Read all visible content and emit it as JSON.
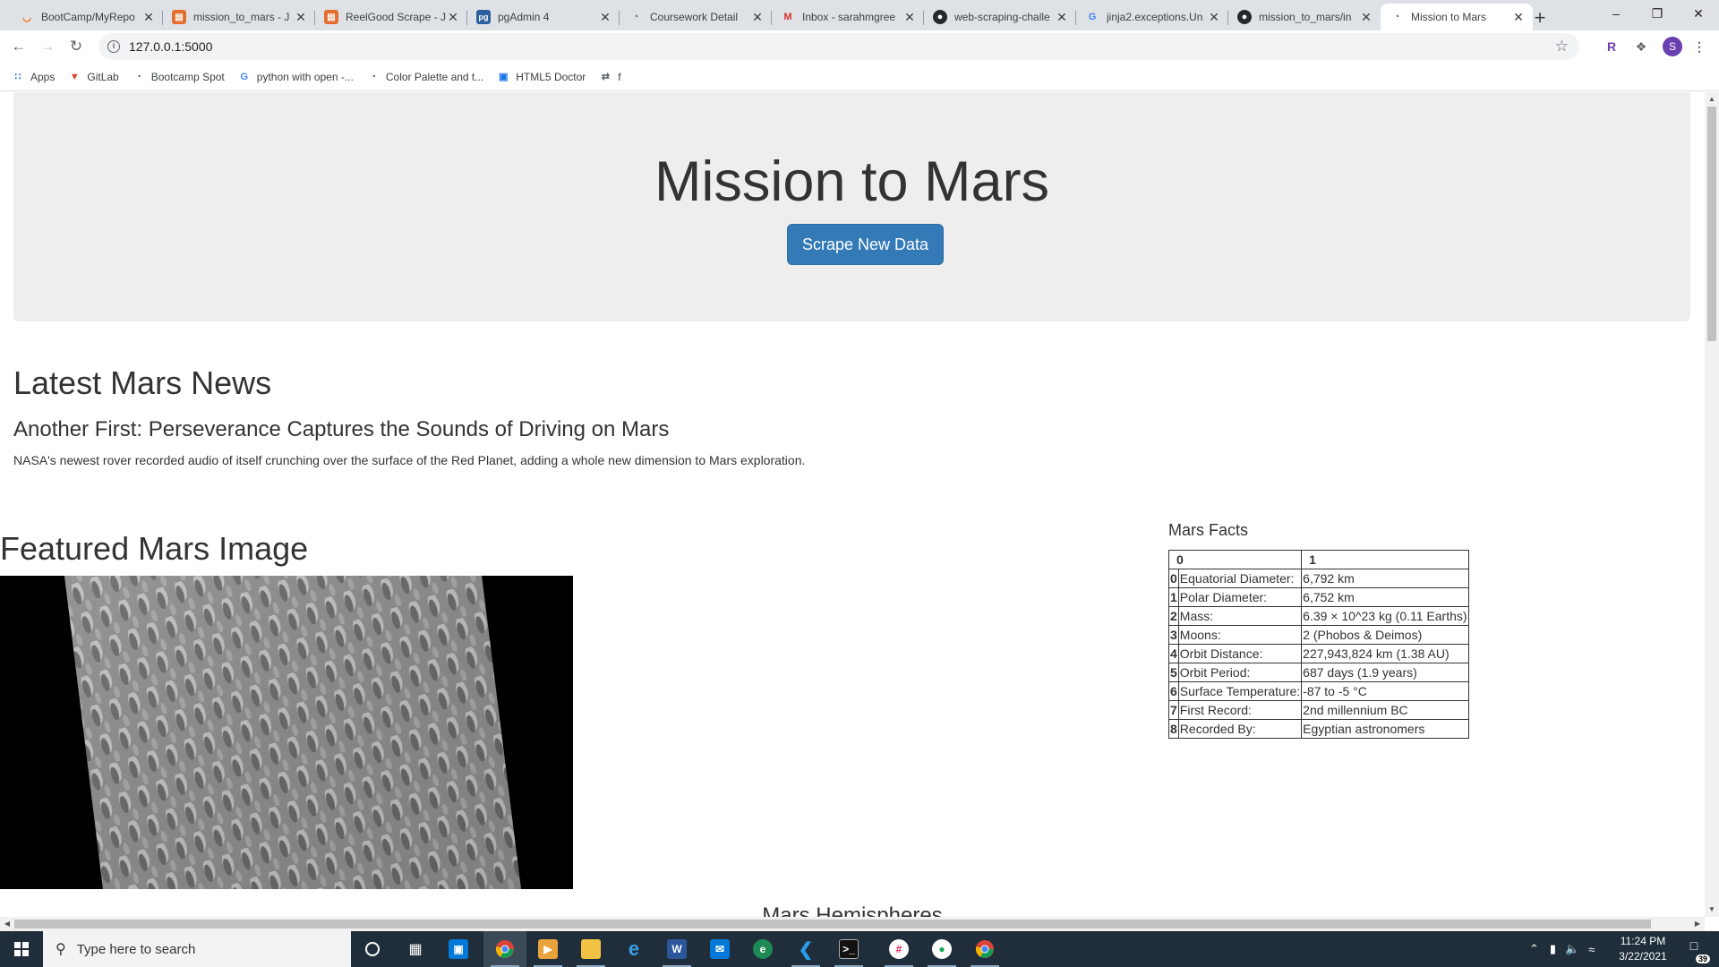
{
  "browser": {
    "tabs": [
      {
        "title": "BootCamp/MyRepo",
        "icon": "bootcamp-icon",
        "color": "#ff6600"
      },
      {
        "title": "mission_to_mars - J",
        "icon": "jupyter-icon",
        "color": "#e46e2e"
      },
      {
        "title": "ReelGood Scrape - J",
        "icon": "jupyter-icon",
        "color": "#e46e2e"
      },
      {
        "title": "pgAdmin 4",
        "icon": "pgadmin-icon",
        "color": "#2c5f9e"
      },
      {
        "title": "Coursework Detail",
        "icon": "globe-icon",
        "color": "#5f6368"
      },
      {
        "title": "Inbox - sarahmgree",
        "icon": "gmail-icon",
        "color": "#d93025"
      },
      {
        "title": "web-scraping-challe",
        "icon": "github-icon",
        "color": "#24292e"
      },
      {
        "title": "jinja2.exceptions.Un",
        "icon": "google-icon",
        "color": "#4285f4"
      },
      {
        "title": "mission_to_mars/in",
        "icon": "github-icon",
        "color": "#24292e"
      },
      {
        "title": "Mission to Mars",
        "icon": "globe-icon",
        "color": "#5f6368"
      }
    ],
    "active_tab_index": 9,
    "url": "127.0.0.1:5000",
    "bookmarks": [
      {
        "label": "Apps",
        "icon": "apps-grid-icon"
      },
      {
        "label": "GitLab",
        "icon": "gitlab-icon"
      },
      {
        "label": "Bootcamp Spot",
        "icon": "globe-icon"
      },
      {
        "label": "python with open -...",
        "icon": "google-icon"
      },
      {
        "label": "Color Palette and t...",
        "icon": "globe-icon"
      },
      {
        "label": "HTML5 Doctor",
        "icon": "html5doctor-icon"
      },
      {
        "label": "f",
        "icon": "link-icon"
      }
    ],
    "profile_initial": "S"
  },
  "page": {
    "title": "Mission to Mars",
    "scrape_button": "Scrape New Data",
    "news": {
      "heading": "Latest Mars News",
      "title": "Another First: Perseverance Captures the Sounds of Driving on Mars",
      "paragraph": "NASA's newest rover recorded audio of itself crunching over the surface of the Red Planet, adding a whole new dimension to Mars exploration."
    },
    "featured": {
      "heading": "Featured Mars Image"
    },
    "facts": {
      "heading": "Mars Facts",
      "columns": [
        "",
        "0",
        "1"
      ],
      "rows": [
        {
          "index": "0",
          "label": "Equatorial Diameter:",
          "value": "6,792 km"
        },
        {
          "index": "1",
          "label": "Polar Diameter:",
          "value": "6,752 km"
        },
        {
          "index": "2",
          "label": "Mass:",
          "value": "6.39 × 10^23 kg (0.11 Earths)"
        },
        {
          "index": "3",
          "label": "Moons:",
          "value": "2 (Phobos & Deimos)"
        },
        {
          "index": "4",
          "label": "Orbit Distance:",
          "value": "227,943,824 km (1.38 AU)"
        },
        {
          "index": "5",
          "label": "Orbit Period:",
          "value": "687 days (1.9 years)"
        },
        {
          "index": "6",
          "label": "Surface Temperature:",
          "value": "-87 to -5 °C"
        },
        {
          "index": "7",
          "label": "First Record:",
          "value": "2nd millennium BC"
        },
        {
          "index": "8",
          "label": "Recorded By:",
          "value": "Egyptian astronomers"
        }
      ]
    },
    "hemispheres": {
      "heading": "Mars Hemispheres"
    }
  },
  "taskbar": {
    "search_placeholder": "Type here to search",
    "time": "11:24 PM",
    "date": "3/22/2021",
    "notification_count": "39"
  }
}
